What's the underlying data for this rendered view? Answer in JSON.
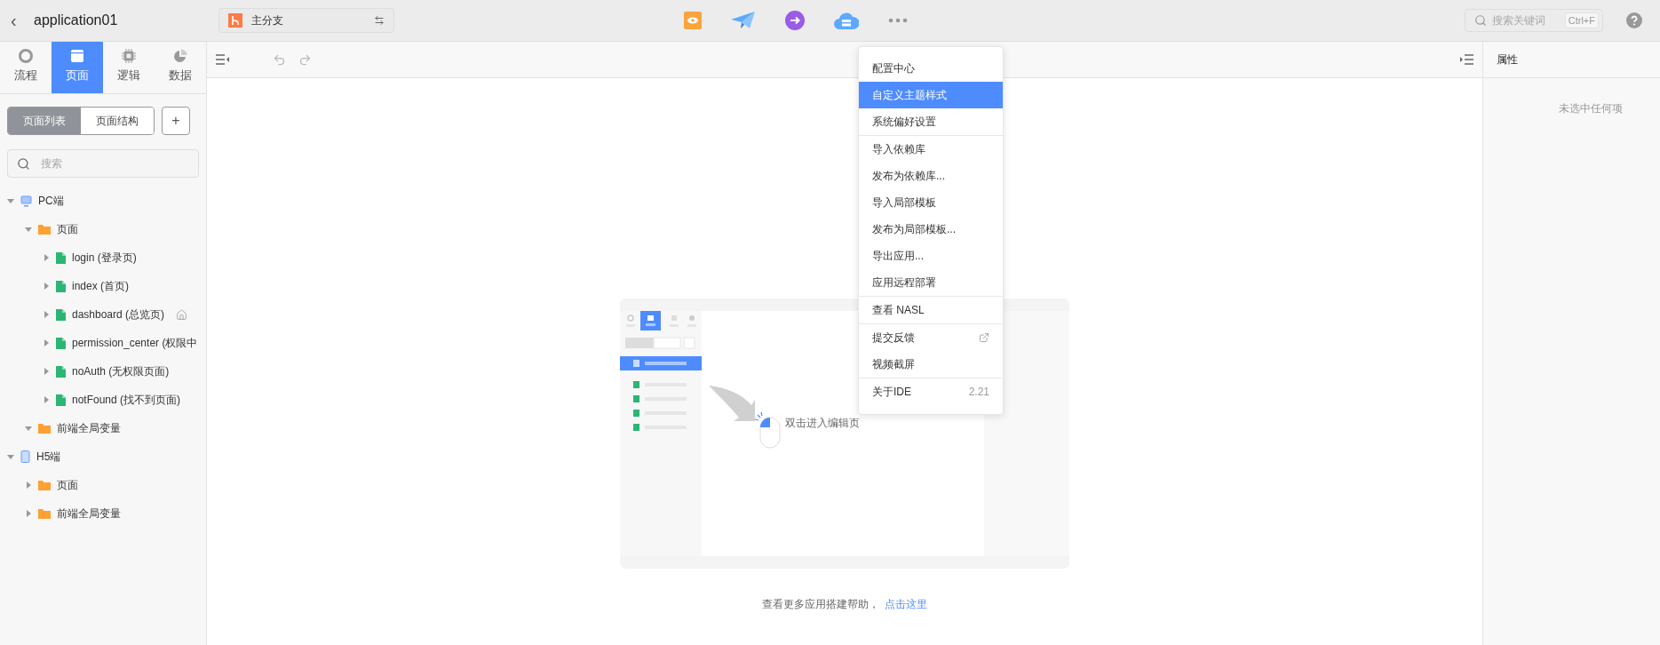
{
  "header": {
    "back": "‹",
    "title": "application01",
    "branch": {
      "name": "主分支"
    },
    "search": {
      "placeholder": "搜索关键词",
      "shortcut": "Ctrl+F"
    }
  },
  "sidebar": {
    "tabs": [
      {
        "label": "流程",
        "selected": false,
        "kind": "flow"
      },
      {
        "label": "页面",
        "selected": true,
        "kind": "page"
      },
      {
        "label": "逻辑",
        "selected": false,
        "kind": "logic"
      },
      {
        "label": "数据",
        "selected": false,
        "kind": "data"
      }
    ],
    "modes": [
      {
        "label": "页面列表",
        "selected": true
      },
      {
        "label": "页面结构",
        "selected": false
      }
    ],
    "add": "+",
    "search": {
      "placeholder": "搜索"
    },
    "tree": [
      {
        "label": "PC端",
        "kind": "pc",
        "expanded": true,
        "children": [
          {
            "label": "页面",
            "kind": "folder",
            "expanded": true,
            "children": [
              {
                "label": "login (登录页)",
                "kind": "page",
                "expanded": false,
                "home": false
              },
              {
                "label": "index (首页)",
                "kind": "page",
                "expanded": false,
                "home": false
              },
              {
                "label": "dashboard (总览页)",
                "kind": "page",
                "expanded": false,
                "home": true
              },
              {
                "label": "permission_center (权限中",
                "kind": "page",
                "expanded": false,
                "home": false
              },
              {
                "label": "noAuth (无权限页面)",
                "kind": "page",
                "expanded": false,
                "home": false
              },
              {
                "label": "notFound (找不到页面)",
                "kind": "page",
                "expanded": false,
                "home": false
              }
            ]
          },
          {
            "label": "前端全局变量",
            "kind": "folder",
            "expanded": true
          }
        ]
      },
      {
        "label": "H5端",
        "kind": "h5",
        "expanded": true,
        "children": [
          {
            "label": "页面",
            "kind": "folder",
            "expanded": false
          },
          {
            "label": "前端全局变量",
            "kind": "folder",
            "expanded": false
          }
        ]
      }
    ]
  },
  "canvas": {
    "hint": "双击进入编辑页",
    "help_text": "查看更多应用搭建帮助，",
    "help_link": "点击这里"
  },
  "menu": [
    [
      {
        "label": "配置中心",
        "selected": false,
        "kind": "plain"
      },
      {
        "label": "自定义主题样式",
        "selected": true,
        "kind": "plain"
      },
      {
        "label": "系统偏好设置",
        "selected": false,
        "kind": "plain"
      }
    ],
    [
      {
        "label": "导入依赖库",
        "selected": false,
        "kind": "plain"
      },
      {
        "label": "发布为依赖库...",
        "selected": false,
        "kind": "plain"
      },
      {
        "label": "导入局部模板",
        "selected": false,
        "kind": "plain"
      },
      {
        "label": "发布为局部模板...",
        "selected": false,
        "kind": "plain"
      },
      {
        "label": "导出应用...",
        "selected": false,
        "kind": "plain"
      },
      {
        "label": "应用远程部署",
        "selected": false,
        "kind": "plain"
      }
    ],
    [
      {
        "label": "查看 NASL",
        "selected": false,
        "kind": "plain"
      }
    ],
    [
      {
        "label": "提交反馈",
        "selected": false,
        "kind": "external"
      },
      {
        "label": "视频截屏",
        "selected": false,
        "kind": "plain"
      }
    ],
    [
      {
        "label": "关于IDE",
        "selected": false,
        "kind": "version",
        "note": "2.21"
      }
    ]
  ],
  "properties": {
    "title": "属性",
    "empty": "未选中任何项"
  }
}
